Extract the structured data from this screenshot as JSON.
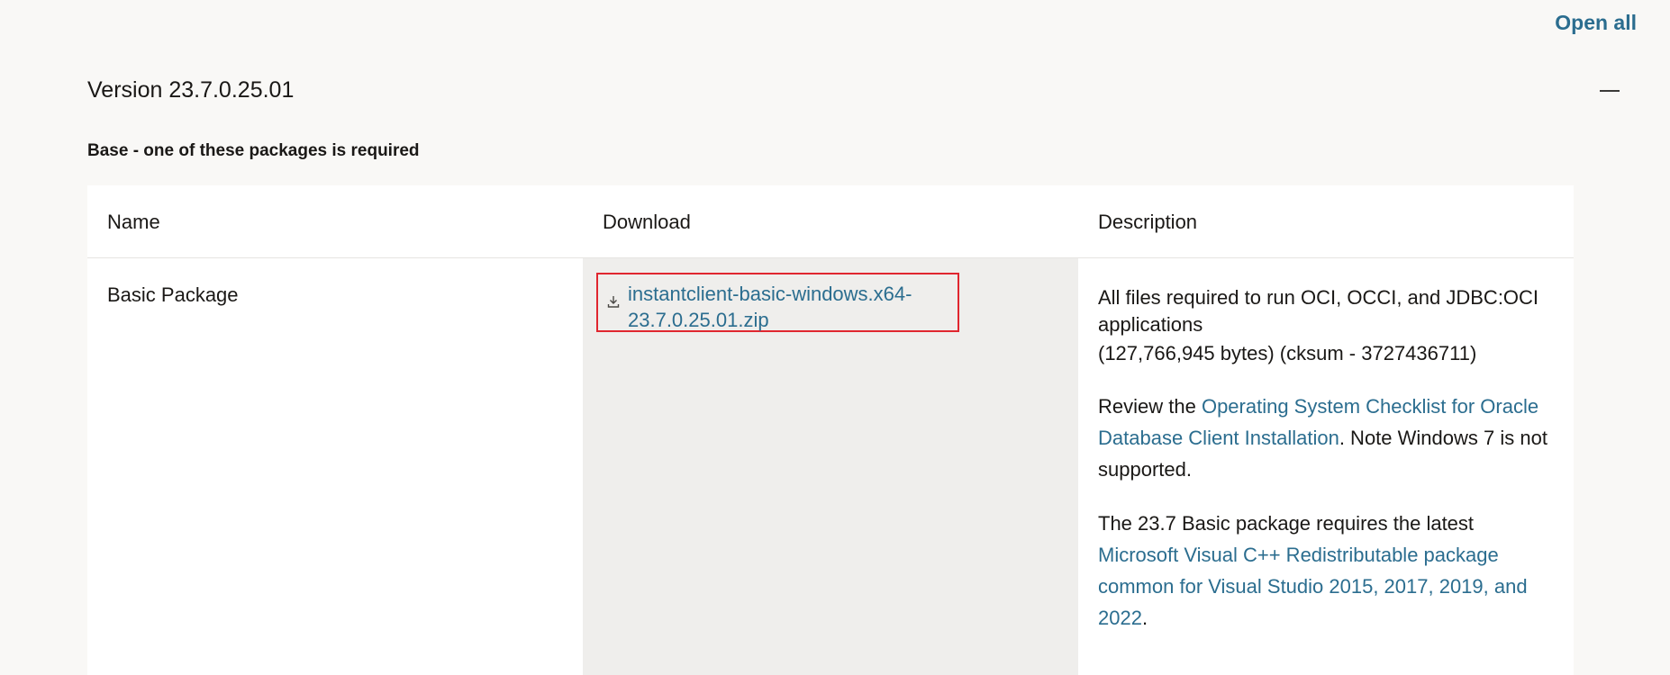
{
  "header": {
    "open_all_label": "Open all"
  },
  "version": {
    "title": "Version 23.7.0.25.01"
  },
  "section": {
    "heading": "Base - one of these packages is required"
  },
  "table": {
    "columns": [
      "Name",
      "Download",
      "Description"
    ],
    "rows": [
      {
        "name": "Basic Package",
        "download_label": "instantclient-basic-windows.x64-23.7.0.25.01.zip",
        "description": {
          "line1": "All files required to run OCI, OCCI, and JDBC:OCI applications",
          "size": "(127,766,945 bytes) (cksum - 3727436711)",
          "review_prefix": "Review the ",
          "review_link": "Operating System Checklist for Oracle Database Client Installation",
          "review_suffix": ". Note Windows 7 is not supported.",
          "vc_prefix": "The 23.7 Basic package requires the latest ",
          "vc_link": "Microsoft Visual C++ Redistributable package common for Visual Studio 2015, 2017, 2019, and 2022",
          "vc_suffix": "."
        }
      }
    ]
  },
  "icons": {
    "collapse": "minus-icon",
    "download": "download-icon"
  },
  "colors": {
    "link": "#2b6d8f",
    "highlight_border": "#e0262f",
    "page_background": "#f9f8f6",
    "download_column_bg": "#efeeec"
  }
}
